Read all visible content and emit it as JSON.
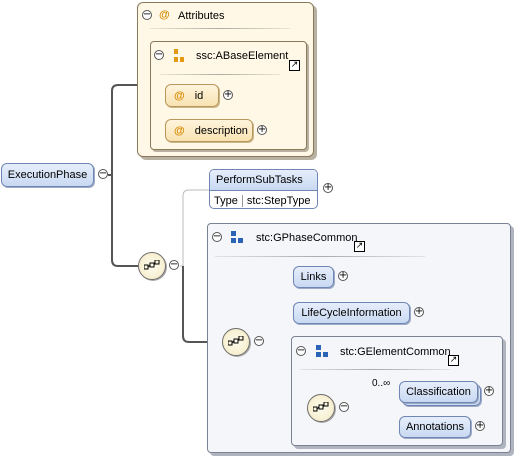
{
  "root": {
    "label": "ExecutionPhase"
  },
  "attributes_group": {
    "title": "Attributes",
    "base_element": {
      "label": "ssc:ABaseElement"
    },
    "attributes": [
      {
        "label": "id"
      },
      {
        "label": "description"
      }
    ]
  },
  "perform_subtasks": {
    "label": "PerformSubTasks",
    "type_key": "Type",
    "type_value": "stc:StepType"
  },
  "gphase_common": {
    "label": "stc:GPhaseCommon",
    "children": [
      {
        "label": "Links"
      },
      {
        "label": "LifeCycleInformation"
      }
    ]
  },
  "gelement_common": {
    "label": "stc:GElementCommon",
    "cardinality": "0..∞",
    "children": [
      {
        "label": "Classification"
      },
      {
        "label": "Annotations"
      }
    ]
  },
  "symbols": {
    "collapse": "⊖",
    "expand": "⊕",
    "attribute_marker": "@",
    "link_arrow": "↗"
  }
}
